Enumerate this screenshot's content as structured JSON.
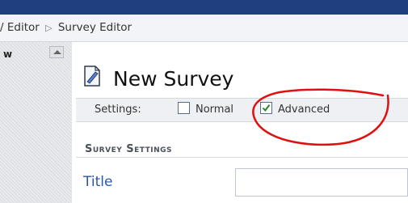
{
  "breadcrumb": {
    "parent": "/ Editor",
    "separator": "▷",
    "current": "Survey Editor"
  },
  "left_panel": {
    "label": "w"
  },
  "page": {
    "title": "New Survey"
  },
  "settings": {
    "label": "Settings:",
    "options": [
      {
        "label": "Normal",
        "checked": false
      },
      {
        "label": "Advanced",
        "checked": true
      }
    ]
  },
  "section": {
    "heading": "Survey Settings"
  },
  "fields": {
    "title_label": "Title",
    "title_value": ""
  },
  "colors": {
    "topbar": "#1f3f7f",
    "annotation": "#e01010",
    "field_label": "#2a57a8"
  }
}
